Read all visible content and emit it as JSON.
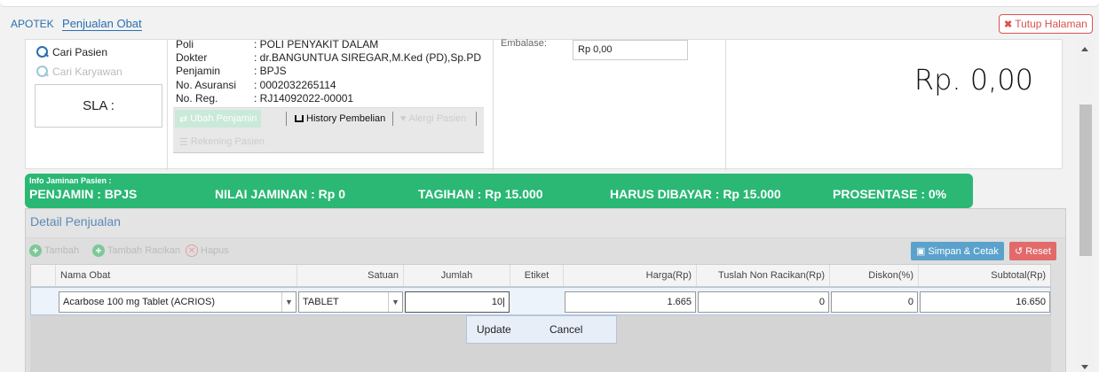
{
  "breadcrumb": {
    "app": "APOTEK",
    "page": "Penjualan Obat"
  },
  "close_button": {
    "label": "Tutup Halaman",
    "icon": "close-icon"
  },
  "left_panel": {
    "cari_pasien": "Cari Pasien",
    "cari_karyawan": "Cari Karyawan",
    "sla": "SLA :"
  },
  "patient_info": {
    "rows": [
      {
        "key": "Poli",
        "value": ": POLI PENYAKIT DALAM"
      },
      {
        "key": "Dokter",
        "value": ": dr.BANGUNTUA SIREGAR,M.Ked (PD),Sp.PD"
      },
      {
        "key": "Penjamin",
        "value": ": BPJS"
      },
      {
        "key": "No. Asuransi",
        "value": ": 0002032265114"
      },
      {
        "key": "No. Reg.",
        "value": ": RJ14092022-00001"
      }
    ],
    "buttons": {
      "ubah_penjamin": "Ubah Penjamin",
      "history": "History Pembelian",
      "alergi": "Alergi Pasien",
      "rekening": "Rekening Pasien"
    }
  },
  "embalase": {
    "label": "Embalase:",
    "value": "Rp 0,00"
  },
  "total": "Rp. 0,00",
  "jaminan": {
    "title": "Info Jaminan Pasien :",
    "penjamin": "PENJAMIN : BPJS",
    "nilai": "NILAI JAMINAN : Rp 0",
    "tagihan": "TAGIHAN : Rp 15.000",
    "harus": "HARUS DIBAYAR : Rp 15.000",
    "prosentase": "PROSENTASE : 0%"
  },
  "detail": {
    "title": "Detail Penjualan",
    "toolbar": {
      "tambah": "Tambah",
      "tambah_racikan": "Tambah Racikan",
      "hapus": "Hapus",
      "simpan": "Simpan & Cetak",
      "reset": "Reset"
    },
    "columns": [
      "Nama Obat",
      "Satuan",
      "Jumlah",
      "Etiket",
      "Harga(Rp)",
      "Tuslah Non Racikan(Rp)",
      "Diskon(%)",
      "Subtotal(Rp)"
    ],
    "row": {
      "nama_obat": "Acarbose 100 mg Tablet (ACRIOS)",
      "satuan": "TABLET",
      "jumlah": "10",
      "harga": "1.665",
      "tuslah": "0",
      "diskon": "0",
      "subtotal": "16.650"
    },
    "popup": {
      "update": "Update",
      "cancel": "Cancel"
    }
  },
  "colors": {
    "accent": "#2a6fb0",
    "banner": "#2ab874",
    "danger": "#d9534f",
    "save": "#5aa2cc"
  }
}
